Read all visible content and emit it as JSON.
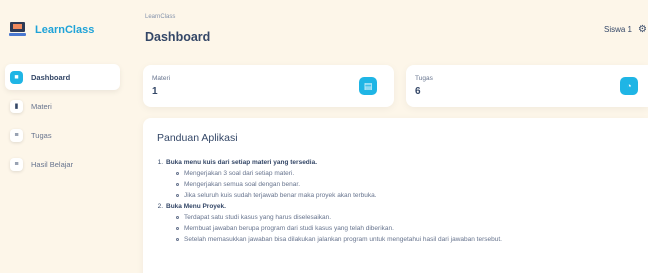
{
  "sidebar": {
    "brand": "LearnClass",
    "items": [
      {
        "label": "Dashboard",
        "icon": "home-icon",
        "active": true
      },
      {
        "label": "Materi",
        "icon": "chart-icon",
        "active": false
      },
      {
        "label": "Tugas",
        "icon": "list-icon",
        "active": false
      },
      {
        "label": "Hasil Belajar",
        "icon": "list-icon",
        "active": false
      }
    ]
  },
  "header": {
    "breadcrumb": "LearnClass",
    "title": "Dashboard",
    "user": "Siswa 1"
  },
  "stats": [
    {
      "label": "Materi",
      "value": "1",
      "icon": "document-icon"
    },
    {
      "label": "Tugas",
      "value": "6",
      "icon": "clock-icon"
    }
  ],
  "guide": {
    "title": "Panduan Aplikasi",
    "sections": [
      {
        "number": "1.",
        "text": "Buka menu kuis dari setiap materi yang tersedia.",
        "items": [
          "Mengerjakan 3 soal dari setiap materi.",
          "Mengerjakan semua soal dengan benar.",
          "Jika seluruh kuis sudah terjawab benar maka proyek akan terbuka."
        ]
      },
      {
        "number": "2.",
        "text": "Buka Menu Proyek.",
        "items": [
          "Terdapat satu studi kasus yang harus diselesaikan.",
          "Membuat jawaban berupa program dari studi kasus yang telah diberikan.",
          "Setelah memasukkan jawaban bisa dilakukan jalankan program untuk mengetahui hasil dari jawaban tersebut."
        ]
      }
    ]
  },
  "colors": {
    "accent": "#1fb5e5",
    "brand": "#1fa3d8",
    "background": "#fdf6e9",
    "text": "#344767"
  }
}
